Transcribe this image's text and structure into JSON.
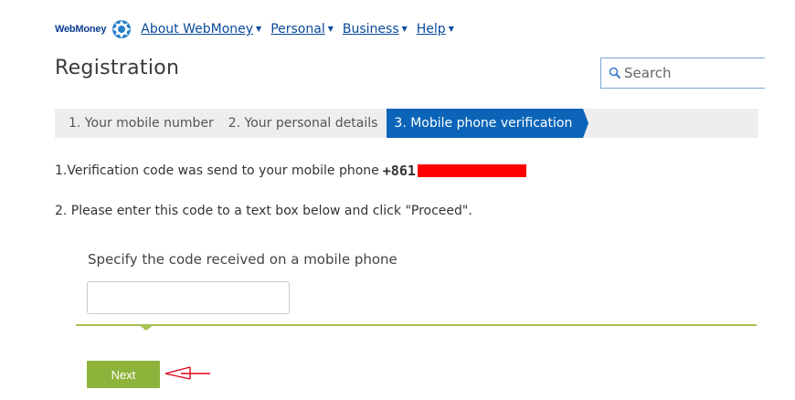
{
  "header": {
    "brand": "WebMoney",
    "logo_icon": "globe-icon",
    "nav": [
      {
        "label": "About WebMoney"
      },
      {
        "label": "Personal"
      },
      {
        "label": "Business"
      },
      {
        "label": "Help"
      }
    ]
  },
  "page": {
    "title": "Registration"
  },
  "search": {
    "placeholder": "Search",
    "icon": "magnifier-icon"
  },
  "steps": [
    {
      "label": "1. Your mobile number",
      "active": false
    },
    {
      "label": "2. Your personal details",
      "active": false
    },
    {
      "label": "3. Mobile phone verification",
      "active": true
    }
  ],
  "instructions": {
    "line1": "1.Verification code was send to your mobile phone ",
    "phone_prefix": "+861",
    "line2": "2. Please enter this code to a text box below and click \"Proceed\"."
  },
  "form": {
    "code_label": "Specify the code received on a mobile phone",
    "code_value": "",
    "next_label": "Next"
  },
  "colors": {
    "link": "#0a4a9a",
    "active_step": "#0b64b8",
    "accent_green": "#8db33b",
    "divider_green": "#a6c255",
    "redaction": "#ff0000",
    "annotation_arrow": "#e0001b"
  }
}
